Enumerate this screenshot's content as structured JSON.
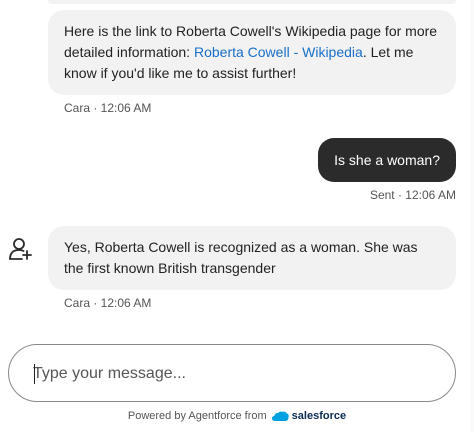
{
  "messages": [
    {
      "text_before": "Here is the link to Roberta Cowell's Wikipedia page for more detailed information: ",
      "link": "Roberta Cowell - Wikipedia",
      "text_after": ". Let me know if you'd like me to assist further!",
      "meta": "Cara · 12:06 AM"
    },
    {
      "text": "Is she a woman?",
      "meta": "Sent · 12:06 AM"
    },
    {
      "text": "Yes, Roberta Cowell is recognized as a woman. She was the first known British transgender",
      "meta": "Cara · 12:06 AM"
    }
  ],
  "composer": {
    "placeholder": "Type your message..."
  },
  "footer": {
    "powered": "Powered by Agentforce from",
    "brand": "salesforce",
    "brand_color": "#00a1e0"
  },
  "icons": {
    "avatar": "person-add-icon"
  }
}
